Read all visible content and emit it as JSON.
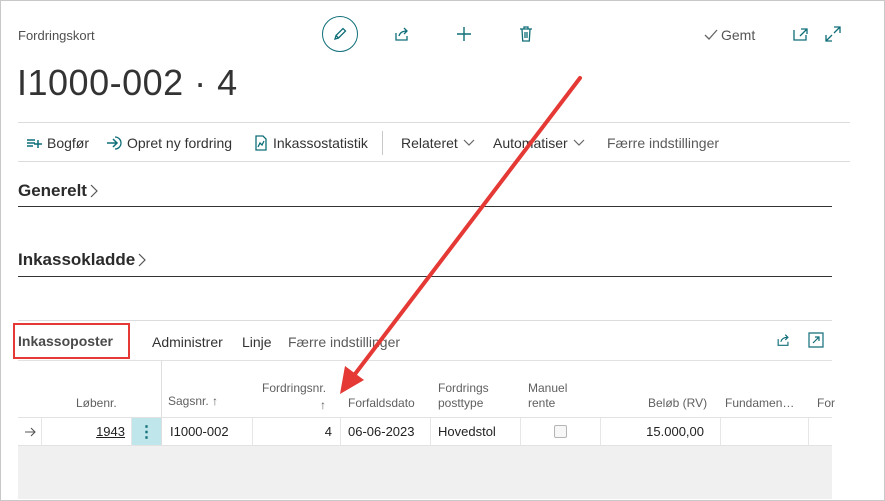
{
  "page": {
    "caption": "Fordringskort",
    "title": "I1000-002 · 4",
    "saved_label": "Gemt"
  },
  "actions": [
    {
      "label": "Bogfør",
      "icon": "post-icon"
    },
    {
      "label": "Opret ny fordring",
      "icon": "create-icon"
    },
    {
      "label": "Inkassostatistik",
      "icon": "statistics-icon"
    },
    {
      "label": "Relateret",
      "icon": "chevron-down-icon"
    },
    {
      "label": "Automatiser",
      "icon": "chevron-down-icon"
    },
    {
      "label": "Færre indstillinger"
    }
  ],
  "sections": {
    "general": "Generelt",
    "journal": "Inkassokladde"
  },
  "lines": {
    "title": "Inkassoposter",
    "actions": [
      "Administrer",
      "Linje",
      "Færre indstillinger"
    ],
    "columns": [
      {
        "l1": "Løbenr.",
        "l2": ""
      },
      {
        "l1": "Sagsnr. ↑",
        "l2": ""
      },
      {
        "l1": "Fordringsnr.",
        "l2": "↑"
      },
      {
        "l1": "Forfaldsdato",
        "l2": ""
      },
      {
        "l1": "Fordrings",
        "l2": "posttype"
      },
      {
        "l1": "Manuel",
        "l2": "rente"
      },
      {
        "l1": "Beløb (RV)",
        "l2": ""
      },
      {
        "l1": "Fundamen…",
        "l2": ""
      },
      {
        "l1": "For",
        "l2": ""
      }
    ],
    "rows": [
      {
        "lobenr": "1943",
        "sagsnr": "I1000-002",
        "fordringsnr": "4",
        "forfaldsdato": "06-06-2023",
        "posttype": "Hovedstol",
        "manuel_rente": false,
        "belob": "15.000,00",
        "fundament": ""
      }
    ]
  },
  "colors": {
    "accent": "#0f6e78",
    "annotation": "#e53935"
  }
}
